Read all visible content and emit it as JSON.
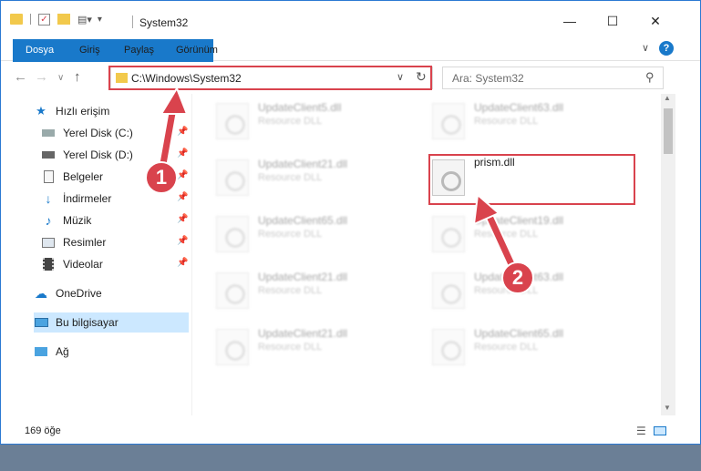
{
  "window": {
    "title": "System32"
  },
  "ribbon": {
    "tabs": [
      "Dosya",
      "Giriş",
      "Paylaş",
      "Görünüm"
    ]
  },
  "address": {
    "path": "C:\\Windows\\System32"
  },
  "search": {
    "placeholder": "Ara: System32"
  },
  "sidebar": {
    "items": [
      {
        "label": "Hızlı erişim"
      },
      {
        "label": "Yerel Disk (C:)"
      },
      {
        "label": "Yerel Disk (D:)"
      },
      {
        "label": "Belgeler"
      },
      {
        "label": "İndirmeler"
      },
      {
        "label": "Müzik"
      },
      {
        "label": "Resimler"
      },
      {
        "label": "Videolar"
      },
      {
        "label": "OneDrive"
      },
      {
        "label": "Bu bilgisayar"
      },
      {
        "label": "Ağ"
      }
    ]
  },
  "files": [
    {
      "name": "UpdateClient5.dll",
      "type": "Resource DLL"
    },
    {
      "name": "UpdateClient63.dll",
      "type": "Resource DLL"
    },
    {
      "name": "UpdateClient21.dll",
      "type": "Resource DLL"
    },
    {
      "name": "prism.dll",
      "type": ""
    },
    {
      "name": "UpdateClient65.dll",
      "type": "Resource DLL"
    },
    {
      "name": "UpdateClient19.dll",
      "type": "Resource DLL"
    },
    {
      "name": "UpdateClient21.dll",
      "type": "Resource DLL"
    },
    {
      "name": "UpdateClient63.dll",
      "type": "Resource DLL"
    },
    {
      "name": "UpdateClient21.dll",
      "type": "Resource DLL"
    },
    {
      "name": "UpdateClient65.dll",
      "type": "Resource DLL"
    }
  ],
  "status": {
    "count": "169 öğe"
  },
  "annotations": {
    "step1": "1",
    "step2": "2"
  },
  "colors": {
    "accent": "#1979ca",
    "highlight": "#d9434d",
    "selected": "#cce8ff"
  }
}
